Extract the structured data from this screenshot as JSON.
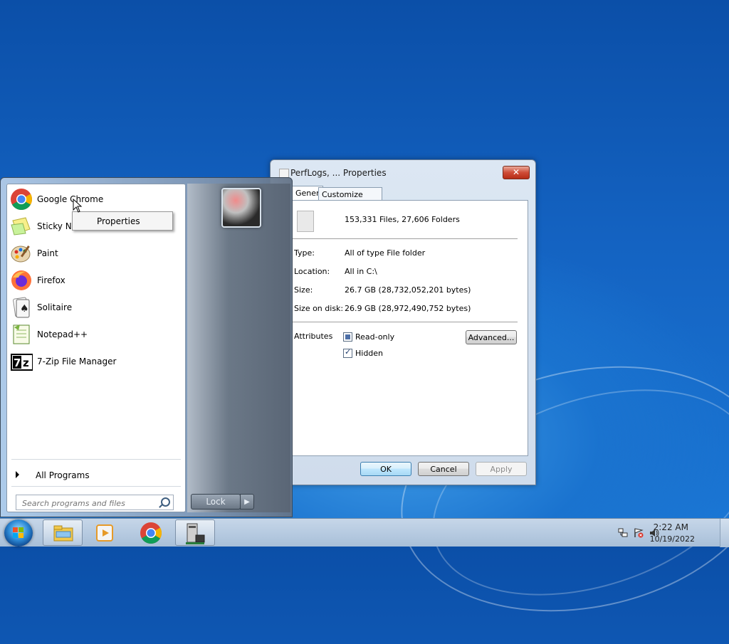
{
  "dialog": {
    "title": "PerfLogs, ... Properties",
    "close_label": "✕",
    "tabs": [
      "General",
      "Customize"
    ],
    "contains": "153,331 Files, 27,606 Folders",
    "rows": [
      {
        "label": "Type:",
        "value": "All of type File folder"
      },
      {
        "label": "Location:",
        "value": "All in C:\\"
      },
      {
        "label": "Size:",
        "value": "26.7 GB (28,732,052,201 bytes)"
      },
      {
        "label": "Size on disk:",
        "value": "26.9 GB (28,972,490,752 bytes)"
      }
    ],
    "attributes_label": "Attributes",
    "readonly_label": "Read-only",
    "hidden_label": "Hidden",
    "advanced_label": "Advanced...",
    "ok_label": "OK",
    "cancel_label": "Cancel",
    "apply_label": "Apply"
  },
  "start_menu": {
    "programs": [
      {
        "label": "Google Chrome",
        "icon": "chrome-icon"
      },
      {
        "label": "Sticky Notes",
        "icon": "sticky-notes-icon"
      },
      {
        "label": "Paint",
        "icon": "paint-icon"
      },
      {
        "label": "Firefox",
        "icon": "firefox-icon"
      },
      {
        "label": "Solitaire",
        "icon": "solitaire-icon"
      },
      {
        "label": "Notepad++",
        "icon": "notepad-plus-plus-icon"
      },
      {
        "label": "7-Zip File Manager",
        "icon": "7zip-icon"
      }
    ],
    "all_programs": "All Programs",
    "search_placeholder": "Search programs and files",
    "lock_label": "Lock"
  },
  "context_menu": {
    "items": [
      "Properties"
    ]
  },
  "taskbar": {
    "pinned": [
      "windows-explorer-icon",
      "media-player-icon",
      "chrome-icon",
      "pc-icon"
    ],
    "time": "2:22 AM",
    "date": "10/19/2022"
  }
}
